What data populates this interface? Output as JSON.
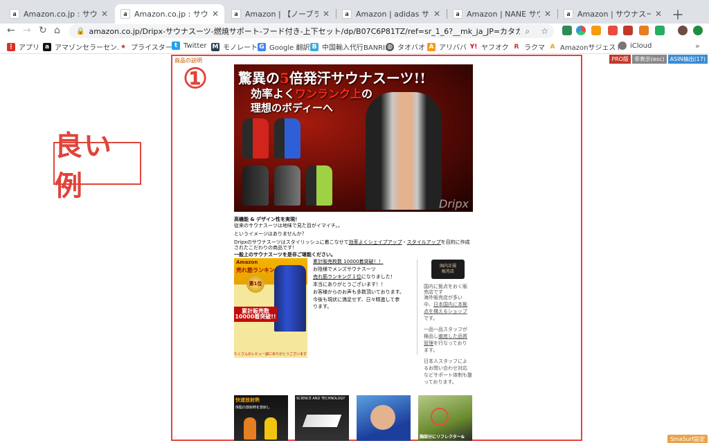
{
  "tabs": [
    {
      "title": "Amazon.co.jp : サウナスーツ",
      "favicon": "a",
      "active": false
    },
    {
      "title": "Amazon.co.jp : サウナスーツ",
      "favicon": "a",
      "active": true
    },
    {
      "title": "Amazon | 【ノーブランド】 ヒ",
      "favicon": "a",
      "active": false
    },
    {
      "title": "Amazon | adidas サウナスーツ",
      "favicon": "a",
      "active": false
    },
    {
      "title": "Amazon | NANE サウナスーツ",
      "favicon": "a",
      "active": false
    },
    {
      "title": "Amazon | サウナスーツ (ジャン",
      "favicon": "a",
      "active": false
    }
  ],
  "toolbar": {
    "url": "amazon.co.jp/Dripx-サウナスーツ-燃焼サポート-フード付き-上下セット/dp/B07C6P81TZ/ref=sr_1_6?__mk_ja_JP=カタカナ&dchild=1&key..."
  },
  "bookmarks": [
    {
      "label": "アプリ",
      "icon": "apps-icon",
      "color": "#d93025"
    },
    {
      "label": "アマゾンセラーセン...",
      "icon": "amazon-icon",
      "color": "#111111"
    },
    {
      "label": "プライスター",
      "icon": "star-icon",
      "color": "#c0392b"
    },
    {
      "label": "Twitter",
      "icon": "twitter-icon",
      "color": "#1da1f2"
    },
    {
      "label": "モノレート",
      "icon": "monorate-icon",
      "color": "#2c3e50"
    },
    {
      "label": "Google 翻訳",
      "icon": "translate-icon",
      "color": "#4285f4"
    },
    {
      "label": "中国輸入代行BANRI...",
      "icon": "banri-icon",
      "color": "#3fa9d8"
    },
    {
      "label": "タオバオ",
      "icon": "globe-icon",
      "color": "#555555"
    },
    {
      "label": "アリババ",
      "icon": "alibaba-icon",
      "color": "#f39c12"
    },
    {
      "label": "ヤフオク",
      "icon": "yahoo-icon",
      "color": "#d9041a"
    },
    {
      "label": "ラクマ",
      "icon": "rakuma-icon",
      "color": "#c0392b"
    },
    {
      "label": "Amazonサジェスト",
      "icon": "amazon-suggest-icon",
      "color": "#f39c12"
    },
    {
      "label": "iCloud",
      "icon": "apple-icon",
      "color": "#777777"
    }
  ],
  "page": {
    "pro_buttons": [
      "PRO版",
      "非表示(esc)",
      "ASIN抽出(17)"
    ],
    "good_example_label": "良い例",
    "section_label": "商品の説明",
    "number_mark": "①",
    "hero": {
      "line1_a": "驚異の",
      "line1_b": "5",
      "line1_c": "倍発汗サウナスーツ!!",
      "line2_a": "効率よく",
      "line2_b": "ワンランク上",
      "line2_c": "の",
      "line3": "理想のボディーへ",
      "brand": "Dripx"
    },
    "description": [
      "高機能 & デザイン性を実現！",
      "従来のサウナスーツは地味で見た目がイマイチ。。",
      "というイメージはありませんか？",
      "Dripxのサウナスーツはスタイリッシュに着こなせて",
      "効率よくシェイプアップ",
      "・",
      "スタイルアップ",
      "を目的に作成",
      "されたこだわりの商品です！",
      "一般上のサウナスーツを是非ご堪能ください。"
    ],
    "rank_image": {
      "line1": "Amazon",
      "line2": "売れ筋ランキング",
      "medal": "第1位",
      "total": "累計販売数 10000着突破!!",
      "bottom": "たくさんのレビュー誠にありがとうございます！"
    },
    "mid_text": [
      "累計販売枚数 10000着突破！！",
      "お陰様でメンズサウナスーツ",
      "売れ筋ランキング１位",
      "になりました！",
      "本当にありがとうございます！！",
      "お客様からのお声も多数頂いております。",
      "今後も現状に満足せず、日々精進して参",
      "ります。"
    ],
    "badge": [
      "国内正規",
      "販売店"
    ],
    "side_text": [
      "国内に拠点をおく販",
      "売店です",
      "海外販売店が多い",
      "中、",
      "日本国内に本拠",
      "点を構えるショップ",
      "です。",
      "一品一品スタッフが",
      "検品し",
      "徹底した品質",
      "管理",
      "を行なっており",
      "ます。",
      "日本人スタッフによ",
      "るお問い合わせ対応",
      "などサポート体制も整",
      "っております。"
    ],
    "thumbs": [
      {
        "top": "快速放射熱",
        "sub": "体脂の放射熱を放射し",
        "bottom": ""
      },
      {
        "top": "SCIENCE AND TECHNOLOGY",
        "sub": "",
        "bottom": ""
      },
      {
        "top": "",
        "sub": "",
        "bottom": ""
      },
      {
        "top": "",
        "sub": "",
        "bottom": "胸部分にリフレクター&"
      }
    ],
    "smasurf": "SmaSurf設定"
  }
}
